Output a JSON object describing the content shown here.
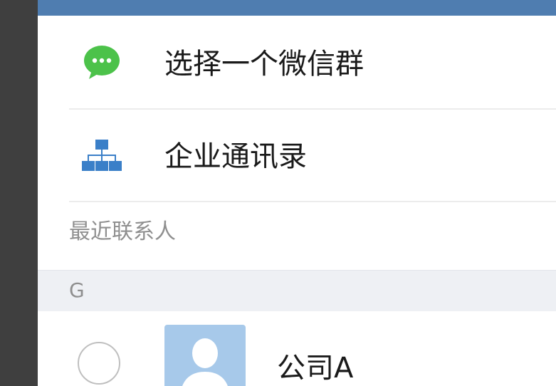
{
  "menu": {
    "items": [
      {
        "label": "选择一个微信群",
        "icon": "wechat-chat-icon"
      },
      {
        "label": "企业通讯录",
        "icon": "org-chart-icon"
      }
    ]
  },
  "recent": {
    "label": "最近联系人"
  },
  "contacts": {
    "sections": [
      {
        "letter": "G",
        "items": [
          {
            "name": "公司A",
            "avatar": "default-person-avatar",
            "selected": false
          }
        ]
      }
    ]
  },
  "colors": {
    "top_bar": "#4f7db0",
    "wechat_green": "#4cc24a",
    "org_blue": "#3a7fc8",
    "avatar_bg": "#a7c9ea"
  }
}
